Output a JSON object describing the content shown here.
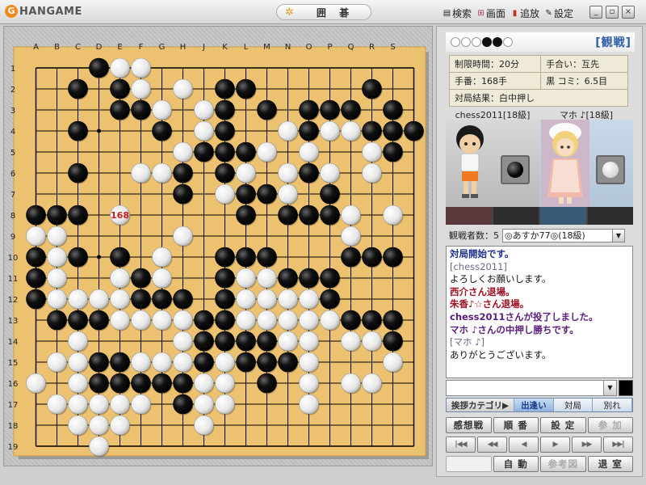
{
  "app": {
    "logo_text": "HANGAME",
    "title": "囲 碁"
  },
  "top_menu": [
    {
      "label": "検索",
      "icon": "binoculars-icon"
    },
    {
      "label": "画面",
      "icon": "screen-grid-icon"
    },
    {
      "label": "追放",
      "icon": "card-icon"
    },
    {
      "label": "設定",
      "icon": "wrench-icon"
    }
  ],
  "window_buttons": {
    "minimize": "_",
    "restore": "▫",
    "close": "×"
  },
  "board": {
    "columns": [
      "A",
      "B",
      "C",
      "D",
      "E",
      "F",
      "G",
      "H",
      "J",
      "K",
      "L",
      "M",
      "N",
      "O",
      "P",
      "Q",
      "R",
      "S"
    ],
    "rows": [
      "1",
      "2",
      "3",
      "4",
      "5",
      "6",
      "7",
      "8",
      "9",
      "10",
      "11",
      "12",
      "13",
      "14",
      "15",
      "16",
      "17",
      "18",
      "19"
    ],
    "last_move_number": "168",
    "last_move": [
      5,
      8
    ],
    "black": [
      [
        4,
        1
      ],
      [
        3,
        2
      ],
      [
        5,
        2
      ],
      [
        10,
        2
      ],
      [
        11,
        2
      ],
      [
        17,
        2
      ],
      [
        5,
        3
      ],
      [
        6,
        3
      ],
      [
        10,
        3
      ],
      [
        12,
        3
      ],
      [
        14,
        3
      ],
      [
        15,
        3
      ],
      [
        16,
        3
      ],
      [
        18,
        3
      ],
      [
        3,
        4
      ],
      [
        7,
        4
      ],
      [
        10,
        4
      ],
      [
        14,
        4
      ],
      [
        17,
        4
      ],
      [
        18,
        4
      ],
      [
        19,
        4
      ],
      [
        9,
        5
      ],
      [
        10,
        5
      ],
      [
        11,
        5
      ],
      [
        18,
        5
      ],
      [
        3,
        6
      ],
      [
        8,
        6
      ],
      [
        10,
        6
      ],
      [
        14,
        6
      ],
      [
        8,
        7
      ],
      [
        11,
        7
      ],
      [
        12,
        7
      ],
      [
        15,
        7
      ],
      [
        1,
        8
      ],
      [
        2,
        8
      ],
      [
        3,
        8
      ],
      [
        11,
        8
      ],
      [
        13,
        8
      ],
      [
        14,
        8
      ],
      [
        15,
        8
      ],
      [
        1,
        10
      ],
      [
        3,
        10
      ],
      [
        5,
        10
      ],
      [
        10,
        10
      ],
      [
        11,
        10
      ],
      [
        12,
        10
      ],
      [
        16,
        10
      ],
      [
        17,
        10
      ],
      [
        18,
        10
      ],
      [
        1,
        11
      ],
      [
        6,
        11
      ],
      [
        10,
        11
      ],
      [
        13,
        11
      ],
      [
        14,
        11
      ],
      [
        15,
        11
      ],
      [
        1,
        12
      ],
      [
        6,
        12
      ],
      [
        7,
        12
      ],
      [
        8,
        12
      ],
      [
        10,
        12
      ],
      [
        15,
        12
      ],
      [
        2,
        13
      ],
      [
        3,
        13
      ],
      [
        4,
        13
      ],
      [
        9,
        13
      ],
      [
        10,
        13
      ],
      [
        16,
        13
      ],
      [
        17,
        13
      ],
      [
        18,
        13
      ],
      [
        9,
        14
      ],
      [
        10,
        14
      ],
      [
        11,
        14
      ],
      [
        12,
        14
      ],
      [
        18,
        14
      ],
      [
        4,
        15
      ],
      [
        5,
        15
      ],
      [
        9,
        15
      ],
      [
        11,
        15
      ],
      [
        12,
        15
      ],
      [
        13,
        15
      ],
      [
        4,
        16
      ],
      [
        5,
        16
      ],
      [
        6,
        16
      ],
      [
        7,
        16
      ],
      [
        8,
        16
      ],
      [
        12,
        16
      ],
      [
        8,
        17
      ]
    ],
    "white": [
      [
        5,
        1
      ],
      [
        6,
        1
      ],
      [
        6,
        2
      ],
      [
        8,
        2
      ],
      [
        10,
        2
      ],
      [
        6,
        3
      ],
      [
        7,
        3
      ],
      [
        9,
        3
      ],
      [
        7,
        4
      ],
      [
        9,
        4
      ],
      [
        13,
        4
      ],
      [
        15,
        4
      ],
      [
        16,
        4
      ],
      [
        8,
        5
      ],
      [
        10,
        5
      ],
      [
        11,
        5
      ],
      [
        12,
        5
      ],
      [
        14,
        5
      ],
      [
        17,
        5
      ],
      [
        6,
        6
      ],
      [
        7,
        6
      ],
      [
        10,
        6
      ],
      [
        11,
        6
      ],
      [
        13,
        6
      ],
      [
        15,
        6
      ],
      [
        17,
        6
      ],
      [
        10,
        7
      ],
      [
        13,
        7
      ],
      [
        16,
        8
      ],
      [
        18,
        8
      ],
      [
        1,
        9
      ],
      [
        2,
        9
      ],
      [
        8,
        9
      ],
      [
        16,
        9
      ],
      [
        2,
        10
      ],
      [
        7,
        10
      ],
      [
        10,
        10
      ],
      [
        2,
        11
      ],
      [
        5,
        11
      ],
      [
        7,
        11
      ],
      [
        11,
        11
      ],
      [
        12,
        11
      ],
      [
        2,
        12
      ],
      [
        3,
        12
      ],
      [
        4,
        12
      ],
      [
        5,
        12
      ],
      [
        11,
        12
      ],
      [
        12,
        12
      ],
      [
        13,
        12
      ],
      [
        14,
        12
      ],
      [
        5,
        13
      ],
      [
        6,
        13
      ],
      [
        7,
        13
      ],
      [
        8,
        13
      ],
      [
        11,
        13
      ],
      [
        12,
        13
      ],
      [
        13,
        13
      ],
      [
        14,
        13
      ],
      [
        15,
        13
      ],
      [
        3,
        14
      ],
      [
        8,
        14
      ],
      [
        13,
        14
      ],
      [
        14,
        14
      ],
      [
        16,
        14
      ],
      [
        17,
        14
      ],
      [
        2,
        15
      ],
      [
        3,
        15
      ],
      [
        6,
        15
      ],
      [
        7,
        15
      ],
      [
        8,
        15
      ],
      [
        10,
        15
      ],
      [
        14,
        15
      ],
      [
        18,
        15
      ],
      [
        1,
        16
      ],
      [
        3,
        16
      ],
      [
        9,
        16
      ],
      [
        10,
        16
      ],
      [
        14,
        16
      ],
      [
        16,
        16
      ],
      [
        17,
        16
      ],
      [
        2,
        17
      ],
      [
        3,
        17
      ],
      [
        4,
        17
      ],
      [
        5,
        17
      ],
      [
        6,
        17
      ],
      [
        9,
        17
      ],
      [
        10,
        17
      ],
      [
        14,
        17
      ],
      [
        3,
        18
      ],
      [
        4,
        18
      ],
      [
        5,
        18
      ],
      [
        9,
        18
      ],
      [
        4,
        19
      ]
    ]
  },
  "panel": {
    "mode_label": "[観戦]",
    "info": {
      "time_limit": "制限時間：20分",
      "handicap": "手合い：互先",
      "move_count": "手番：168手",
      "komi": "黒 コミ：6.5目",
      "result": "対局結果：白中押し"
    },
    "players": {
      "black_name": "chess2011[18級]",
      "white_name": "マホ ♪[18級]",
      "black_bar_color": "#5a3a3c",
      "white_bar_color": "#3a5a78"
    },
    "viewers_label": "観戦者数：5",
    "viewers_selected": "◎あすか77◎(18級)",
    "chat": [
      {
        "text": "対局開始です。",
        "color": "#1c2f8c",
        "bold": true
      },
      {
        "text": "[chess2011]",
        "color": "#6a6a8a",
        "bold": false
      },
      {
        "text": "よろしくお願いします。",
        "color": "#111111",
        "bold": false
      },
      {
        "text": "西介さん退場。",
        "color": "#a01020",
        "bold": true
      },
      {
        "text": "朱香♪☆さん退場。",
        "color": "#a01020",
        "bold": true
      },
      {
        "text": "chess2011さんが投了しました。",
        "color": "#5a1e7a",
        "bold": true
      },
      {
        "text": "マホ ♪さんの中押し勝ちです。",
        "color": "#5a1e7a",
        "bold": true
      },
      {
        "text": "[マホ ♪]",
        "color": "#6a6a8a",
        "bold": false
      },
      {
        "text": "ありがとうございます。",
        "color": "#111111",
        "bold": false
      }
    ],
    "category_label": "挨拶カテゴリ▶",
    "category_tabs": [
      "出逢い",
      "対局",
      "別れ"
    ],
    "buttons_row1": [
      "感想戦",
      "順 番",
      "設 定",
      "参 加"
    ],
    "nav_buttons": [
      "|◀◀",
      "◀◀",
      "◀",
      "▶",
      "▶▶",
      "▶▶|"
    ],
    "buttons_row3": [
      "",
      "自 動",
      "参考図",
      "退 室"
    ]
  }
}
